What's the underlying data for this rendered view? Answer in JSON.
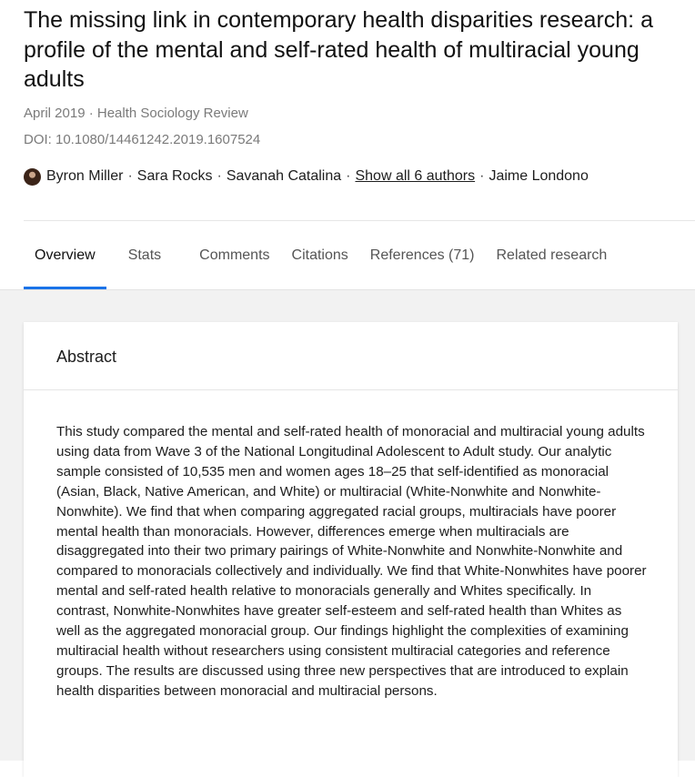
{
  "publication": {
    "title": "The missing link in contemporary health disparities research: a profile of the mental and self-rated health of multiracial young adults",
    "date_source": "April 2019 · Health Sociology Review",
    "doi": "DOI: 10.1080/14461242.2019.1607524"
  },
  "authors": {
    "names": [
      "Byron Miller",
      "Sara Rocks",
      "Savanah Catalina"
    ],
    "separator": "·",
    "show_all": "Show all 6 authors",
    "last": "Jaime Londono"
  },
  "tabs": [
    {
      "label": "Overview",
      "active": true
    },
    {
      "label": "Stats",
      "active": false
    },
    {
      "label": "Comments",
      "active": false
    },
    {
      "label": "Citations",
      "active": false
    },
    {
      "label": "References (71)",
      "active": false
    },
    {
      "label": "Related research",
      "active": false
    }
  ],
  "abstract": {
    "heading": "Abstract",
    "text": "This study compared the mental and self-rated health of monoracial and multiracial young adults using data from Wave 3 of the National Longitudinal Adolescent to Adult study. Our analytic sample consisted of 10,535 men and women ages 18–25 that self-identified as monoracial (Asian, Black, Native American, and White) or multiracial (White-Nonwhite and Nonwhite-Nonwhite). We find that when comparing aggregated racial groups, multiracials have poorer mental health than monoracials. However, differences emerge when multiracials are disaggregated into their two primary pairings of White-Nonwhite and Nonwhite-Nonwhite and compared to monoracials collectively and individually. We find that White-Nonwhites have poorer mental and self-rated health relative to monoracials generally and Whites specifically. In contrast, Nonwhite-Nonwhites have greater self-esteem and self-rated health than Whites as well as the aggregated monoracial group. Our findings highlight the complexities of examining multiracial health without researchers using consistent multiracial categories and reference groups. The results are discussed using three new perspectives that are introduced to explain health disparities between monoracial and multiracial persons."
  },
  "colors": {
    "accent": "#1a73e8",
    "page_background": "#f2f2f2",
    "muted_text": "#7a7a7a"
  }
}
